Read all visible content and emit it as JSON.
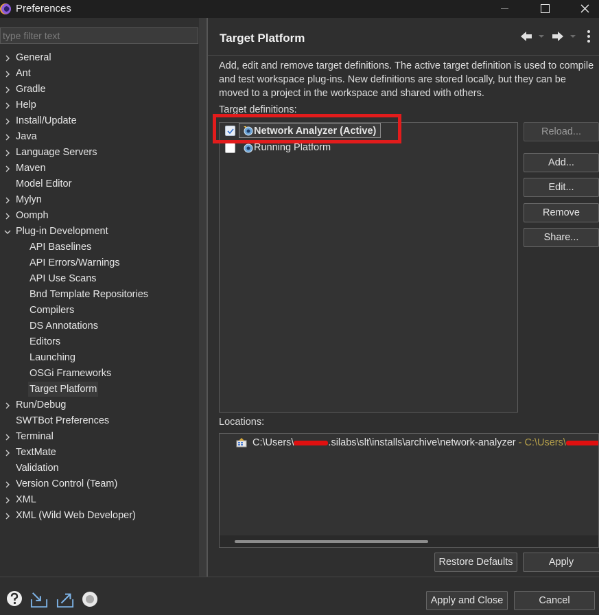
{
  "window": {
    "title": "Preferences"
  },
  "filter": {
    "placeholder": "type filter text"
  },
  "tree": [
    {
      "label": "General",
      "expandable": true,
      "child": false
    },
    {
      "label": "Ant",
      "expandable": true,
      "child": false
    },
    {
      "label": "Gradle",
      "expandable": true,
      "child": false
    },
    {
      "label": "Help",
      "expandable": true,
      "child": false
    },
    {
      "label": "Install/Update",
      "expandable": true,
      "child": false
    },
    {
      "label": "Java",
      "expandable": true,
      "child": false
    },
    {
      "label": "Language Servers",
      "expandable": true,
      "child": false
    },
    {
      "label": "Maven",
      "expandable": true,
      "child": false
    },
    {
      "label": "Model Editor",
      "expandable": false,
      "child": false
    },
    {
      "label": "Mylyn",
      "expandable": true,
      "child": false
    },
    {
      "label": "Oomph",
      "expandable": true,
      "child": false
    },
    {
      "label": "Plug-in Development",
      "expandable": true,
      "expanded": true,
      "child": false
    },
    {
      "label": "API Baselines",
      "expandable": false,
      "child": true
    },
    {
      "label": "API Errors/Warnings",
      "expandable": false,
      "child": true
    },
    {
      "label": "API Use Scans",
      "expandable": false,
      "child": true
    },
    {
      "label": "Bnd Template Repositories",
      "expandable": false,
      "child": true
    },
    {
      "label": "Compilers",
      "expandable": false,
      "child": true
    },
    {
      "label": "DS Annotations",
      "expandable": false,
      "child": true
    },
    {
      "label": "Editors",
      "expandable": false,
      "child": true
    },
    {
      "label": "Launching",
      "expandable": false,
      "child": true
    },
    {
      "label": "OSGi Frameworks",
      "expandable": false,
      "child": true
    },
    {
      "label": "Target Platform",
      "expandable": false,
      "child": true,
      "selected": true
    },
    {
      "label": "Run/Debug",
      "expandable": true,
      "child": false
    },
    {
      "label": "SWTBot Preferences",
      "expandable": false,
      "child": false
    },
    {
      "label": "Terminal",
      "expandable": true,
      "child": false
    },
    {
      "label": "TextMate",
      "expandable": true,
      "child": false
    },
    {
      "label": "Validation",
      "expandable": false,
      "child": false
    },
    {
      "label": "Version Control (Team)",
      "expandable": true,
      "child": false
    },
    {
      "label": "XML",
      "expandable": true,
      "child": false
    },
    {
      "label": "XML (Wild Web Developer)",
      "expandable": true,
      "child": false
    }
  ],
  "page": {
    "title": "Target Platform",
    "description": "Add, edit and remove target definitions.  The active target definition is used to compile and test workspace plug-ins.  New definitions are stored locally, but they can be moved to a project in the workspace and shared with others.",
    "definitions_label": "Target definitions:",
    "locations_label": "Locations:"
  },
  "targets": [
    {
      "label": "Network Analyzer (Active)",
      "checked": true
    },
    {
      "label": "Running Platform",
      "checked": false
    }
  ],
  "buttons": {
    "reload": "Reload...",
    "add": "Add...",
    "edit": "Edit...",
    "remove": "Remove",
    "share": "Share...",
    "restore_defaults": "Restore Defaults",
    "apply": "Apply",
    "apply_close": "Apply and Close",
    "cancel": "Cancel"
  },
  "location": {
    "path_prefix": "C:\\Users\\",
    "path_rest": ".silabs\\slt\\installs\\archive\\network-analyzer",
    "suffix_prefix": " - C:\\Users\\"
  },
  "colors": {
    "highlight": "#e21c1c",
    "background": "#2f2f2f",
    "accent_check": "#2f6fcf"
  },
  "icons": [
    "back-arrow-icon",
    "forward-arrow-icon",
    "more-vertical-icon",
    "help-icon",
    "import-icon",
    "export-icon",
    "oomph-record-icon"
  ]
}
